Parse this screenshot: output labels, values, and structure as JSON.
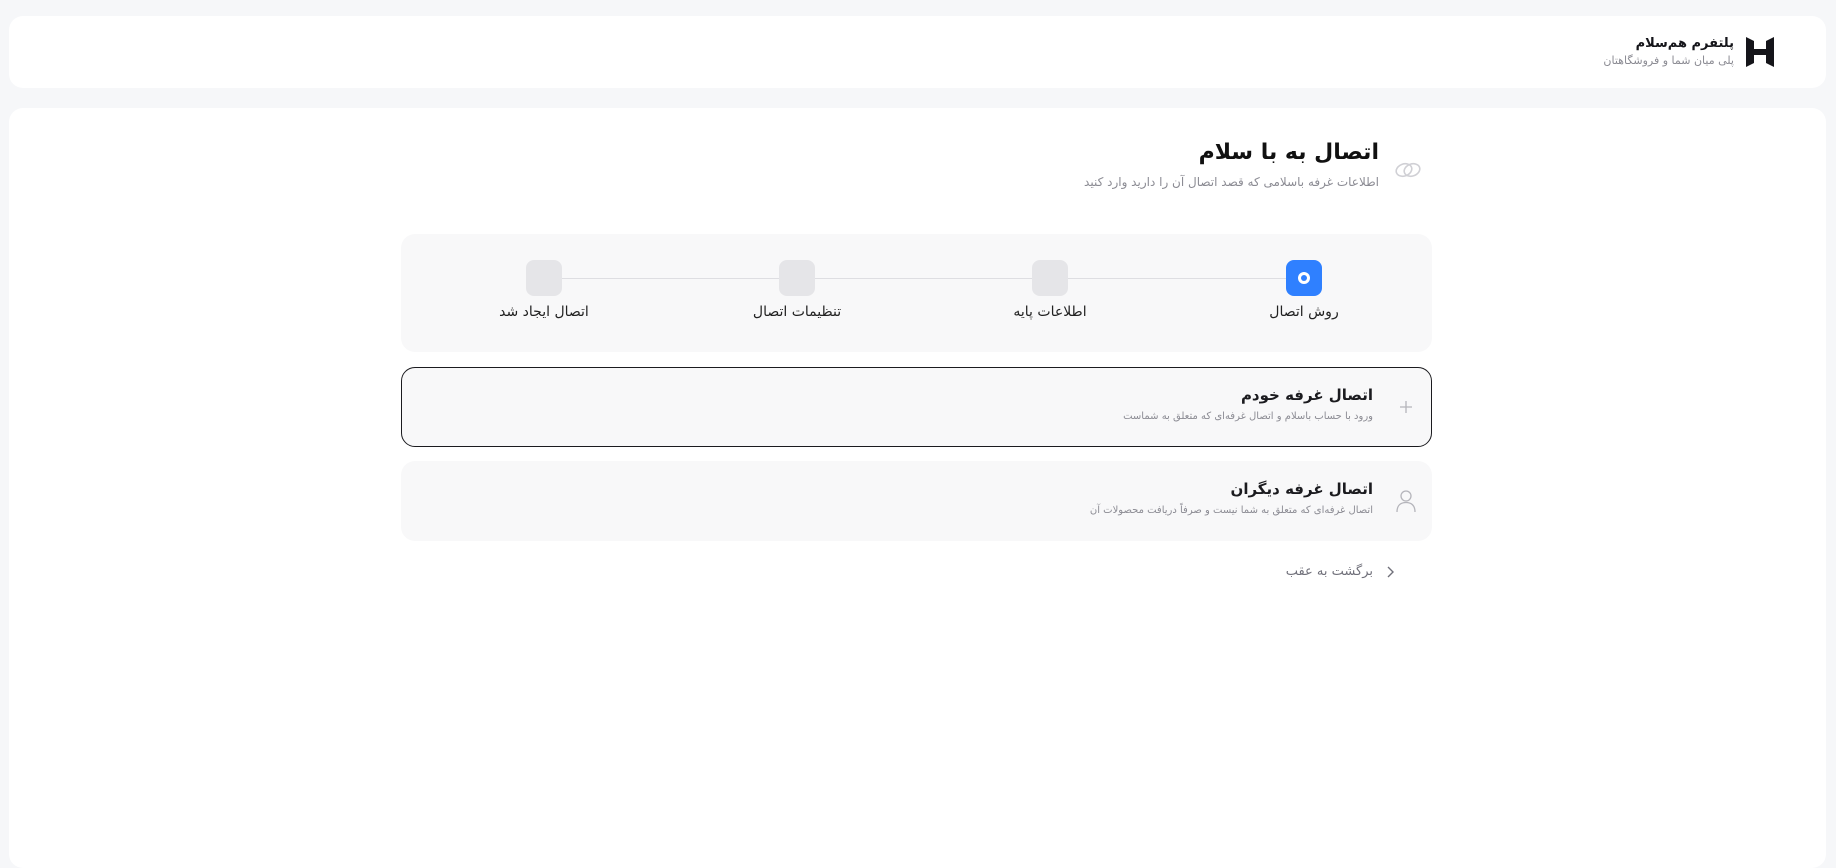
{
  "brand": {
    "title": "پلتفرم هم‌سلام",
    "subtitle": "پلی میان شما و فروشگاهتان",
    "logo_icon": "logo-h-icon"
  },
  "page": {
    "title": "اتصال به با سلام",
    "description": "اطلاعات غرفه باسلامی که قصد اتصال آن را دارید وارد کنید",
    "icon": "link-icon"
  },
  "stepper": {
    "steps": [
      {
        "label": "روش اتصال",
        "active": true
      },
      {
        "label": "اطلاعات پایه",
        "active": false
      },
      {
        "label": "تنظیمات اتصال",
        "active": false
      },
      {
        "label": "اتصال ایجاد شد",
        "active": false
      }
    ],
    "accent_color": "#2f80ff"
  },
  "options": [
    {
      "title": "اتصال غرفه خودم",
      "description": "ورود با حساب باسلام و اتصال غرفه‌ای که متعلق به شماست",
      "icon": "plus-icon",
      "selected": true
    },
    {
      "title": "اتصال غرفه دیگران",
      "description": "اتصال غرفه‌ای که متعلق به شما نیست و صرفاً دریافت محصولات آن",
      "icon": "user-icon",
      "selected": false
    }
  ],
  "back": {
    "label": "برگشت به عقب",
    "icon": "chevron-right-icon"
  }
}
